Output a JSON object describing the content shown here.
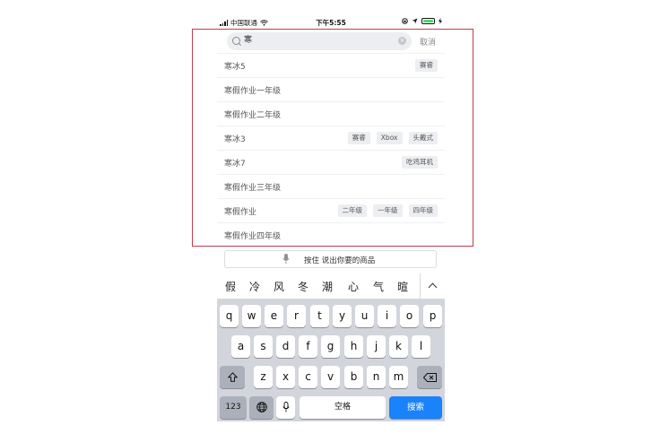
{
  "status_bar": {
    "carrier": "中国联通",
    "time": "下午5:55"
  },
  "search": {
    "query": "寒",
    "cancel_label": "取消"
  },
  "suggestions": [
    {
      "label": "寒冰5",
      "tags": [
        "赛睿"
      ]
    },
    {
      "label": "寒假作业一年级",
      "tags": []
    },
    {
      "label": "寒假作业二年级",
      "tags": []
    },
    {
      "label": "寒冰3",
      "tags": [
        "赛睿",
        "Xbox",
        "头戴式"
      ]
    },
    {
      "label": "寒冰7",
      "tags": [
        "吃鸡耳机"
      ]
    },
    {
      "label": "寒假作业三年级",
      "tags": []
    },
    {
      "label": "寒假作业",
      "tags": [
        "二年级",
        "一年级",
        "四年级"
      ]
    },
    {
      "label": "寒假作业四年级",
      "tags": []
    }
  ],
  "voice": {
    "label": "按住 说出你要的商品"
  },
  "candidates": [
    "假",
    "冷",
    "风",
    "冬",
    "潮",
    "心",
    "气",
    "暄"
  ],
  "keyboard": {
    "row1": [
      "q",
      "w",
      "e",
      "r",
      "t",
      "y",
      "u",
      "i",
      "o",
      "p"
    ],
    "row2": [
      "a",
      "s",
      "d",
      "f",
      "g",
      "h",
      "j",
      "k",
      "l"
    ],
    "row3": [
      "z",
      "x",
      "c",
      "v",
      "b",
      "n",
      "m"
    ],
    "numbers_label": "123",
    "space_label": "空格",
    "search_label": "搜索"
  },
  "colors": {
    "accent": "#1a82fb",
    "highlight": "#c43a4a",
    "battery": "#4cd964"
  }
}
